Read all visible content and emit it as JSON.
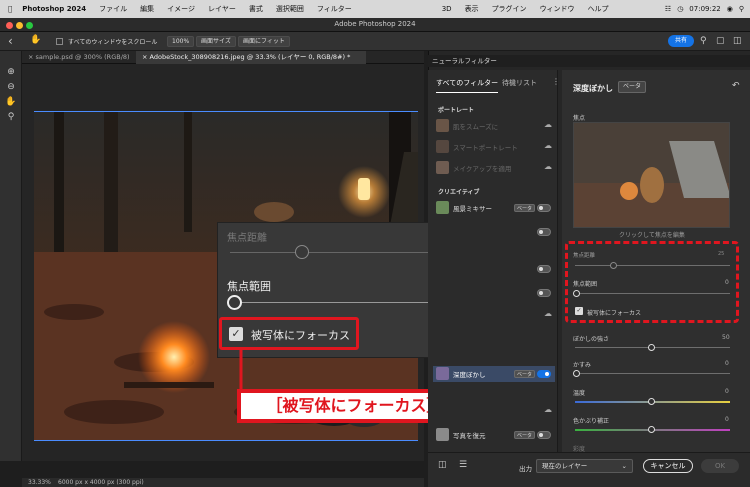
{
  "menubar": {
    "app_name": "Photoshop 2024",
    "items": [
      "ファイル",
      "編集",
      "イメージ",
      "レイヤー",
      "書式",
      "選択範囲",
      "フィルター",
      "3D",
      "表示",
      "プラグイン",
      "ウィンドウ",
      "ヘルプ"
    ],
    "clock": "07:09:22"
  },
  "window_title": "Adobe Photoshop 2024",
  "options_bar": {
    "scroll_all_label": "すべてのウィンドウをスクロール",
    "zoom_100": "100%",
    "fit_screen": "画面サイズ",
    "fill_screen": "画面にフィット",
    "share_label": "共有"
  },
  "tabs": [
    {
      "label": "sample.psd @ 300% (RGB/8)"
    },
    {
      "label": "AdobeStock_308908216.jpeg @ 33.3% (レイヤー 0, RGB/8#) *"
    }
  ],
  "status": {
    "zoom": "33.33%",
    "doc_info": "6000 px x 4000 px (300 ppi)"
  },
  "neural": {
    "header": "ニューラルフィルター",
    "tab_all": "すべてのフィルター",
    "tab_waitlist": "待機リスト",
    "section_portrait": "ポートレート",
    "portrait_items": [
      "肌をスムーズに",
      "スマートポートレート",
      "メイクアップを適用"
    ],
    "section_creative": "クリエイティブ",
    "landscape_mixer": "風景ミキサー",
    "beta_badge": "ベータ",
    "depth_blur": "深度ぼかし",
    "photo_restore": "写真を復元"
  },
  "depth_panel": {
    "title": "深度ぼかし",
    "beta": "ベータ",
    "focal_point": "焦点",
    "click_hint": "クリックして焦点を編集",
    "focal_distance_label": "焦点距離",
    "focal_distance_value": "25",
    "focal_range_label": "焦点範囲",
    "focal_range_value": "0",
    "focus_subject_label": "被写体にフォーカス",
    "blur_strength_label": "ぼかしの強さ",
    "blur_strength_value": "50",
    "haze_label": "かすみ",
    "haze_value": "0",
    "temperature_label": "温度",
    "temperature_value": "0",
    "tint_label": "色かぶり補正",
    "tint_value": "0",
    "extra_label": "彩度"
  },
  "zoom_panel": {
    "focal_distance_label": "焦点距離",
    "focal_distance_value": "25",
    "focal_range_label": "焦点範囲",
    "focal_range_value": "0",
    "focus_subject_label": "被写体にフォーカス"
  },
  "callout": "［被写体にフォーカス］をチェック",
  "bottom": {
    "output_label": "出力",
    "output_value": "現在のレイヤー",
    "cancel": "キャンセル",
    "ok": "OK"
  },
  "colors": {
    "accent": "#1473e6",
    "highlight_red": "#e0161f"
  }
}
